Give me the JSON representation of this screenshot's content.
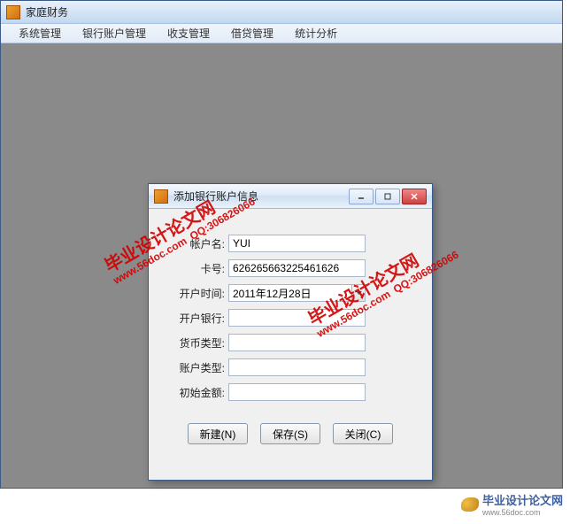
{
  "main": {
    "title": "家庭财务",
    "menu": [
      "系统管理",
      "银行账户管理",
      "收支管理",
      "借贷管理",
      "统计分析"
    ]
  },
  "dialog": {
    "title": "添加银行账户信息",
    "fields": {
      "account_name": {
        "label": "帐户名:",
        "value": "YUI"
      },
      "card_no": {
        "label": "卡号:",
        "value": "626265663225461626"
      },
      "open_date": {
        "label": "开户时间:",
        "value": "2011年12月28日"
      },
      "open_bank": {
        "label": "开户银行:",
        "value": ""
      },
      "currency": {
        "label": "货币类型:",
        "value": ""
      },
      "account_type": {
        "label": "账户类型:",
        "value": ""
      },
      "initial_amount": {
        "label": "初始金额:",
        "value": ""
      }
    },
    "buttons": {
      "new": "新建(N)",
      "save": "保存(S)",
      "close": "关闭(C)"
    }
  },
  "watermark": {
    "main": "毕业设计论文网",
    "url": "www.56doc.com",
    "qq": "QQ:306826066"
  },
  "footer": {
    "text": "毕业设计论文网",
    "url": "www.56doc.com"
  }
}
